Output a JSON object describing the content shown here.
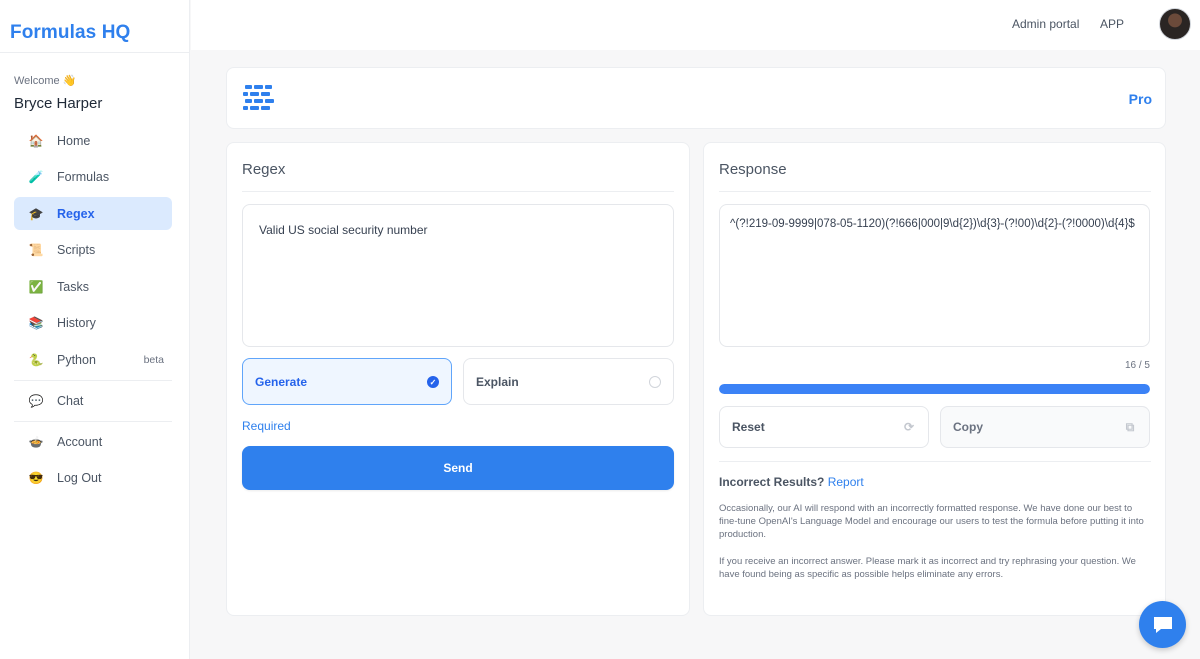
{
  "app": {
    "brand": "Formulas HQ"
  },
  "user": {
    "welcome": "Welcome 👋",
    "name": "Bryce Harper"
  },
  "nav": {
    "home": "Home",
    "formulas": "Formulas",
    "regex": "Regex",
    "scripts": "Scripts",
    "tasks": "Tasks",
    "history": "History",
    "python": "Python",
    "python_badge": "beta",
    "chat": "Chat",
    "account": "Account",
    "logout": "Log Out"
  },
  "icons": {
    "home": "🏠",
    "formulas": "🧪",
    "regex": "🎓",
    "scripts": "📜",
    "tasks": "✅",
    "history": "📚",
    "python": "🐍",
    "chat": "💬",
    "account": "🍲",
    "logout": "😎"
  },
  "header": {
    "admin_portal": "Admin portal",
    "app": "APP"
  },
  "banner": {
    "plan": "Pro"
  },
  "regex_panel": {
    "title": "Regex",
    "input_value": "Valid US social security number",
    "option_generate": "Generate",
    "option_explain": "Explain",
    "selected": "generate",
    "required": "Required",
    "send": "Send"
  },
  "response_panel": {
    "title": "Response",
    "output": "^(?!219-09-9999|078-05-1120)(?!666|000|9\\d{2})\\d{3}-(?!00)\\d{2}-(?!0000)\\d{4}$",
    "counter": "16 / 5",
    "progress": 1.0,
    "reset": "Reset",
    "copy": "Copy",
    "incorrect_label": "Incorrect Results?",
    "report": "Report",
    "disclaimer_1": "Occasionally, our AI will respond with an incorrectly formatted response. We have done our best to fine-tune OpenAI's  Language Model and encourage our users to test the formula before putting it into production.",
    "disclaimer_2": "If you receive an incorrect answer. Please mark it as incorrect and try rephrasing your question. We have found being as specific as possible helps eliminate any errors."
  },
  "colors": {
    "accent": "#2f80ed",
    "active_bg": "#dbeafe"
  }
}
